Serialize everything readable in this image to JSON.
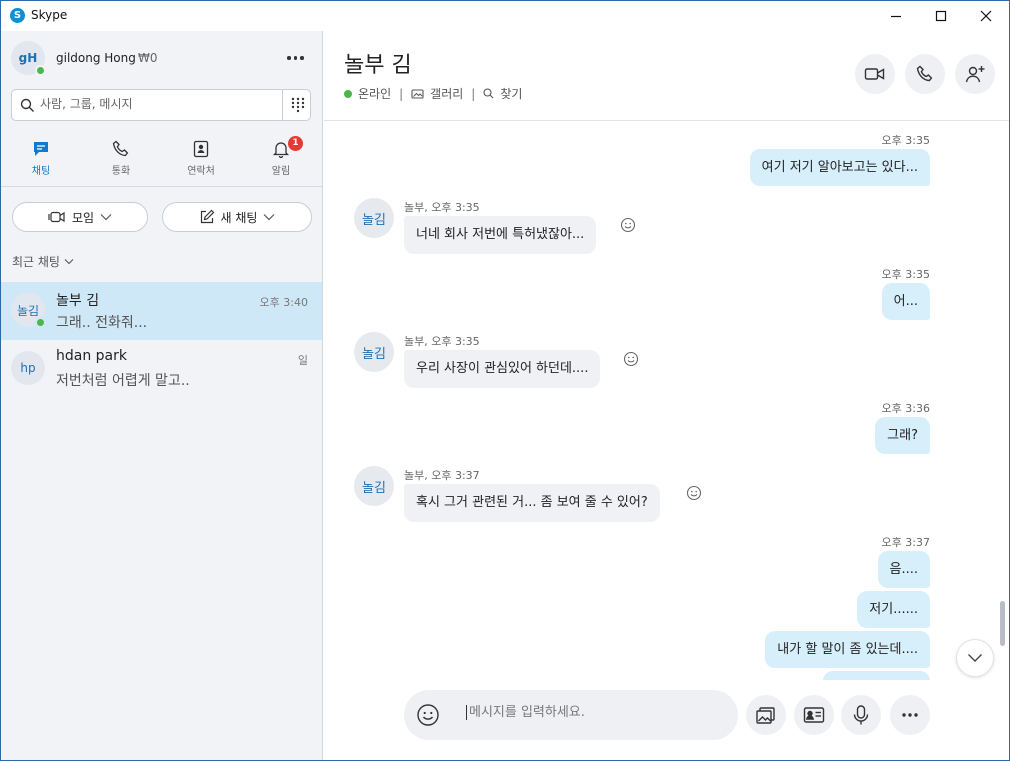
{
  "window": {
    "title": "Skype",
    "logo_letter": "S"
  },
  "me": {
    "initials": "gH",
    "name": "gildong Hong",
    "credit": "₩0"
  },
  "search": {
    "placeholder": "사람, 그룹, 메시지"
  },
  "nav_tabs": [
    {
      "label": "채팅",
      "icon": "chat-icon",
      "active": true
    },
    {
      "label": "통화",
      "icon": "phone-icon",
      "active": false
    },
    {
      "label": "연락처",
      "icon": "contacts-icon",
      "active": false
    },
    {
      "label": "알림",
      "icon": "bell-icon",
      "active": false,
      "badge": "1"
    }
  ],
  "actions": {
    "meet_label": "모임",
    "new_chat_label": "새 채팅"
  },
  "recent_header": "최근 채팅",
  "conversations": [
    {
      "initials": "놀김",
      "name": "놀부 김",
      "preview": "그래.. 전화줘...",
      "time": "오후 3:40",
      "online": true,
      "active": true
    },
    {
      "initials": "hp",
      "name": "hdan park",
      "preview": "저번처럼 어렵게 말고..",
      "time": "일",
      "online": false,
      "active": false
    }
  ],
  "chat": {
    "contact_name": "놀부 김",
    "status": "온라인",
    "gallery": "갤러리",
    "find": "찾기",
    "messages": [
      {
        "dir": "out",
        "time": "오후 3:35",
        "text": "여기 저기 알아보고는 있다..."
      },
      {
        "dir": "in",
        "sender_time": "놀부, 오후 3:35",
        "avatar": "놀김",
        "text": "너네 회사 저번에 특허냈잖아..."
      },
      {
        "dir": "out",
        "time": "오후 3:35",
        "text": "어..."
      },
      {
        "dir": "in",
        "sender_time": "놀부, 오후 3:35",
        "avatar": "놀김",
        "text": "우리 사장이 관심있어 하던데...."
      },
      {
        "dir": "out",
        "time": "오후 3:36",
        "text": "그래?"
      },
      {
        "dir": "in",
        "sender_time": "놀부, 오후 3:37",
        "avatar": "놀김",
        "text": "혹시 그거 관련된 거... 좀 보여 줄 수 있어?"
      },
      {
        "dir": "out",
        "time": "오후 3:37",
        "text": "음...."
      },
      {
        "dir": "out",
        "text": "저기......"
      },
      {
        "dir": "out",
        "text": "내가 할 말이 좀 있는데...."
      }
    ],
    "composer_placeholder": "메시지를 입력하세요."
  },
  "colors": {
    "accent": "#1379c8",
    "online": "#4ab64c",
    "bubble_out": "#d7eefb",
    "badge": "#e53935",
    "selected": "#cfe8f8"
  }
}
